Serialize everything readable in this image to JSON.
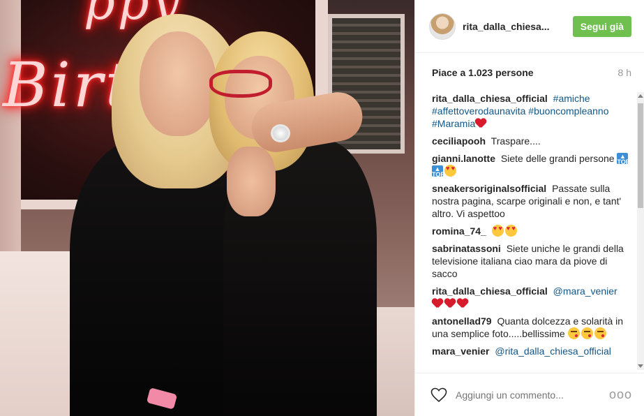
{
  "post": {
    "username": "rita_dalla_chiesa...",
    "follow_label": "Segui già",
    "likes": "Piace a 1.023 persone",
    "time": "8 h",
    "neon_top": "ppy",
    "neon_main": "Birt",
    "comment_placeholder": "Aggiungi un commento...",
    "more_label": "ooo"
  },
  "comments": [
    {
      "user": "rita_dalla_chiesa_official",
      "tags": [
        "#amiche",
        "#affettoverodaunavita",
        "#buoncompleanno",
        "#Maramia"
      ],
      "emojis": [
        "red-heart"
      ]
    },
    {
      "user": "ceciliapooh",
      "text": "Traspare...."
    },
    {
      "user": "gianni.lanotte",
      "text": "Siete delle grandi persone",
      "emojis": [
        "top-arrow",
        "top-arrow",
        "heart-eyes"
      ]
    },
    {
      "user": "sneakersoriginalsofficial",
      "text": "Passate sulla nostra pagina, scarpe originali e non, e tant' altro. Vi aspettoo"
    },
    {
      "user": "romina_74_",
      "emojis": [
        "heart-eyes",
        "heart-eyes"
      ]
    },
    {
      "user": "sabrinatassoni",
      "text": "Siete uniche le grandi della televisione italiana ciao mara da piove di sacco"
    },
    {
      "user": "rita_dalla_chiesa_official",
      "mention": "@mara_venier",
      "emojis": [
        "red-heart",
        "red-heart",
        "red-heart"
      ]
    },
    {
      "user": "antonellad79",
      "text": "Quanta dolcezza e solarità in una semplice foto.....bellissime",
      "emojis": [
        "kiss-face",
        "kiss-face",
        "kiss-face"
      ]
    },
    {
      "user": "mara_venier",
      "mention": "@rita_dalla_chiesa_official"
    }
  ],
  "icons": {
    "like": "heart-outline-icon",
    "more": "more-options-icon"
  },
  "colors": {
    "follow_button": "#70c050",
    "hashtag": "#125688",
    "heart": "#d81b2c"
  }
}
